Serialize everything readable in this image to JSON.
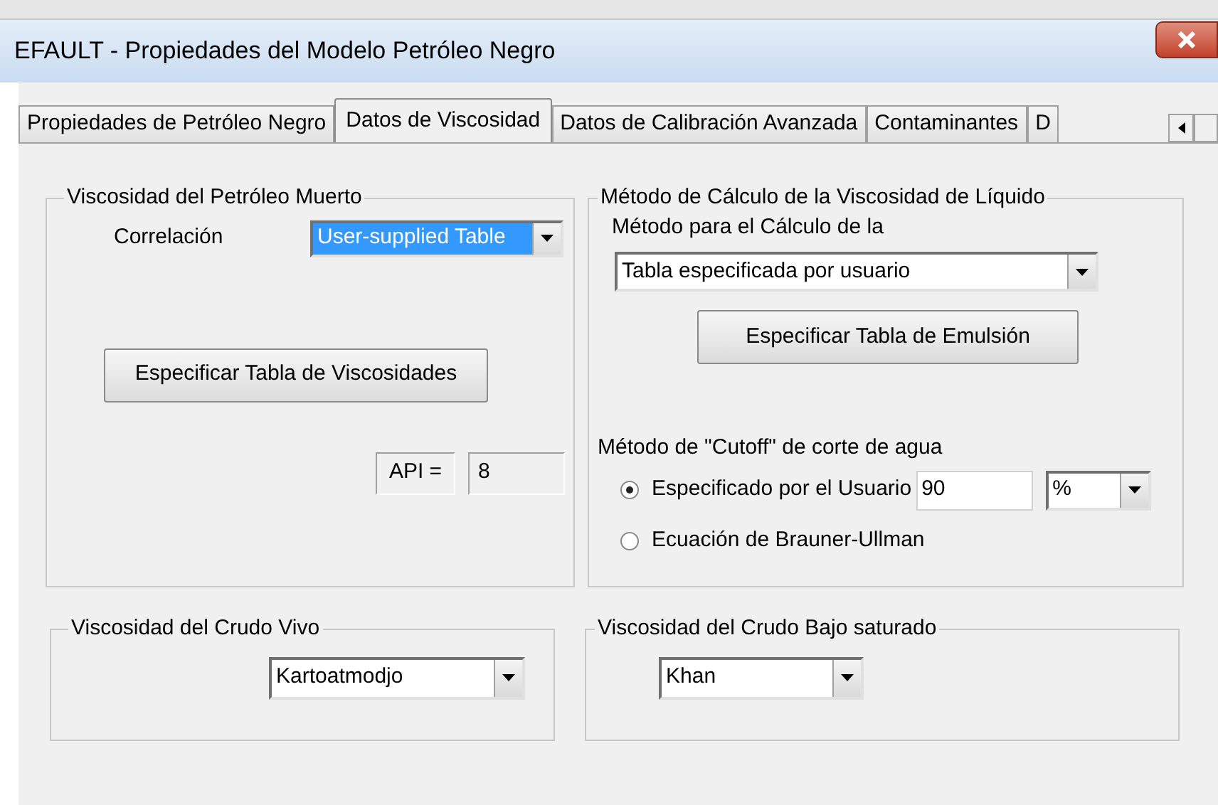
{
  "window": {
    "title": "EFAULT - Propiedades del Modelo Petróleo Negro"
  },
  "tabs": [
    {
      "label": "Propiedades de Petróleo Negro",
      "selected": false
    },
    {
      "label": "Datos de Viscosidad",
      "selected": true
    },
    {
      "label": "Datos de Calibración Avanzada",
      "selected": false
    },
    {
      "label": "Contaminantes",
      "selected": false
    },
    {
      "label": "D",
      "selected": false
    }
  ],
  "dead_oil": {
    "title": "Viscosidad del Petróleo Muerto",
    "correlation_label": "Correlación",
    "correlation": {
      "value": "User-supplied Table",
      "focused": true
    },
    "button": "Especificar Tabla de Viscosidades",
    "api_label": "API =",
    "api_value": "8"
  },
  "liquid": {
    "title": "Método de Cálculo de la Viscosidad de Líquido",
    "method_label": "Método para el Cálculo de la",
    "method": {
      "value": "Tabla especificada por usuario",
      "focused": false
    },
    "button": "Especificar Tabla de Emulsión",
    "cutoff_label": "Método de \"Cutoff\" de corte de agua",
    "options": [
      {
        "label": "Especificado por el Usuario",
        "selected": true,
        "value": "90",
        "unit": "%"
      },
      {
        "label": "Ecuación de Brauner-Ullman",
        "selected": false
      }
    ]
  },
  "live_oil": {
    "title": "Viscosidad del Crudo Vivo",
    "value": "Kartoatmodjo"
  },
  "undersaturated": {
    "title": "Viscosidad del Crudo Bajo saturado",
    "value": "Khan"
  }
}
